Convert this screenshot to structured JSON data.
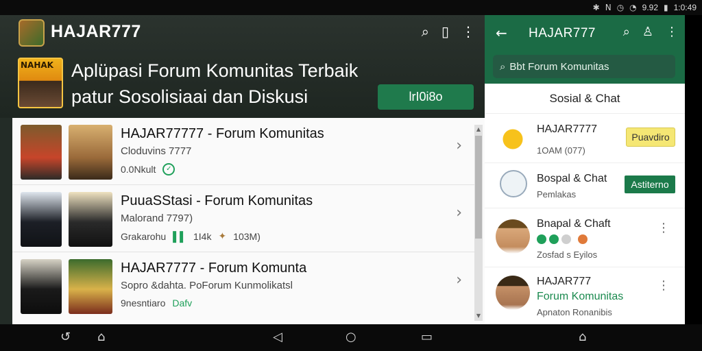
{
  "statusbar": {
    "time": "1:0:49",
    "battery": "9.92",
    "icons": [
      "bluetooth-icon",
      "nfc-icon",
      "alarm-icon",
      "wifi-icon",
      "signal-icon",
      "battery-icon"
    ]
  },
  "left": {
    "app_title": "HAJAR777",
    "headline_line1": "Aplüpasi Forum Komunitas Terbaik",
    "headline_line2": "patur Sosolisiaai dan Diskusi",
    "promo_tag": "NAHAK",
    "cta_label": "lrI0i8o",
    "items": [
      {
        "title": "HAJAR77777 - Forum Komunitas",
        "subtitle": "Cloduvins 7777",
        "meta1": "0.0Nkult",
        "meta2": "",
        "meta3": ""
      },
      {
        "title": "PuuaSStasi - Forum Komunitas",
        "subtitle": "Malorand 7797)",
        "meta1": "Grakarohu",
        "meta2": "1I4k",
        "meta3": "103M)"
      },
      {
        "title": "HAJAR7777 - Forum Komunta",
        "subtitle": "Sopro &dahta. PoForum Kunmolikatsl",
        "meta1": "9nesntiaro",
        "meta2": "Dafv",
        "meta3": ""
      }
    ]
  },
  "right": {
    "title": "HAJAR777",
    "search_text": "Bbt Forum Komunitas",
    "section": "Sosial & Chat",
    "items": [
      {
        "name": "HAJAR7777",
        "sub": "1OAM (077)",
        "button": "Puavdiro"
      },
      {
        "name": "Bospal & Chat",
        "sub": "Pemlakas",
        "button": "Astiterno"
      },
      {
        "name": "Bnapal & Chaft",
        "sub": "Zosfad s Eyilos",
        "button": ""
      },
      {
        "name": "HAJAR777",
        "name2": "Forum Komunitas",
        "sub": "Apnaton Ronanibis",
        "button": ""
      }
    ]
  },
  "colors": {
    "accent_green": "#1b6b45",
    "button_yellow": "#f5e774"
  }
}
